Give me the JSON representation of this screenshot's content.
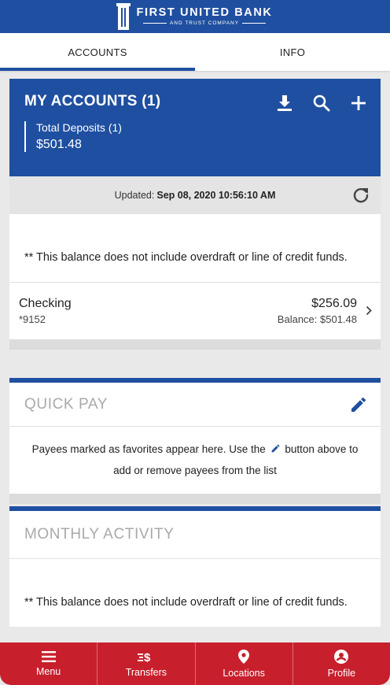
{
  "brand": {
    "name": "FIRST UNITED BANK",
    "tagline": "AND TRUST COMPANY",
    "primary_color": "#1f4fa0",
    "nav_color": "#c81f2c"
  },
  "tabs": [
    {
      "label": "ACCOUNTS",
      "active": true
    },
    {
      "label": "INFO",
      "active": false
    }
  ],
  "my_accounts": {
    "title": "MY ACCOUNTS (1)",
    "tools": [
      "download-icon",
      "search-icon",
      "plus-icon"
    ],
    "total_label": "Total Deposits (1)",
    "total_value": "$501.48",
    "updated_prefix": "Updated:",
    "updated_value": "Sep 08, 2020 10:56:10 AM",
    "notice": "** This balance does not include overdraft or line of credit funds.",
    "accounts": [
      {
        "name": "Checking",
        "number": "*9152",
        "amount": "$256.09",
        "balance": "Balance: $501.48"
      }
    ]
  },
  "quick_pay": {
    "title": "QUICK PAY",
    "message_before": "Payees marked as favorites appear here. Use the",
    "message_after": "button above to add or remove payees from the list"
  },
  "monthly_activity": {
    "title": "MONTHLY ACTIVITY",
    "notice": "** This balance does not include overdraft or line of credit funds."
  },
  "bottom_nav": [
    {
      "label": "Menu",
      "icon": "menu-icon"
    },
    {
      "label": "Transfers",
      "icon": "transfers-icon"
    },
    {
      "label": "Locations",
      "icon": "location-pin-icon"
    },
    {
      "label": "Profile",
      "icon": "profile-icon"
    }
  ]
}
